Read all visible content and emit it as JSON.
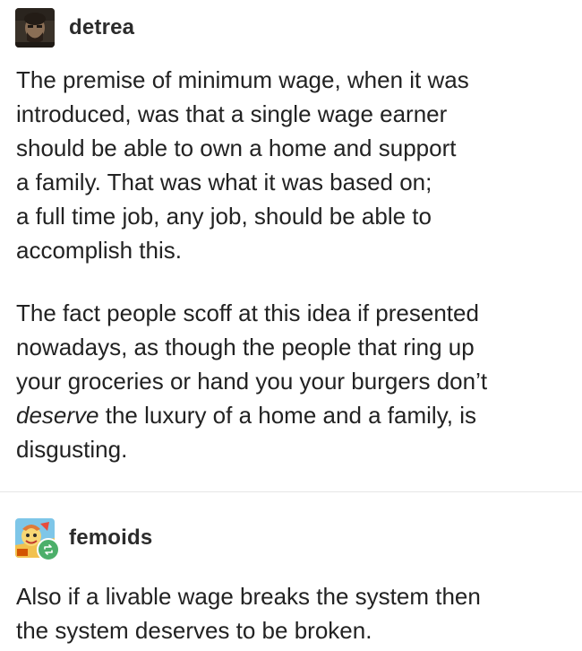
{
  "posts": [
    {
      "username": "detrea",
      "avatar_icon": "user-avatar-photo",
      "paragraphs": [
        {
          "lines": [
            "The premise of minimum wage, when it was",
            "introduced, was that a single wage earner",
            "should be able to own a home and support",
            "a family.  That was what it was based on;",
            "a full time job, any job, should be able to",
            "accomplish this."
          ]
        },
        {
          "lines": [
            "The fact people scoff at this idea if presented",
            "nowadays, as though the people that ring up",
            "your groceries or hand you your burgers don’t"
          ],
          "emphasis": "deserve",
          "after_emphasis": " the luxury of a home and a family, is",
          "last_line": "disgusting."
        }
      ]
    },
    {
      "username": "femoids",
      "avatar_icon": "cartoon-avatar",
      "badge_icon": "reblog-icon",
      "paragraphs": [
        {
          "lines": [
            "Also if a livable wage breaks the system then",
            "the system deserves to be broken."
          ]
        }
      ]
    }
  ],
  "colors": {
    "text": "#222222",
    "username": "#2b2b2b",
    "divider": "#e6e6e6",
    "reblog_badge": "#4caf6a"
  }
}
